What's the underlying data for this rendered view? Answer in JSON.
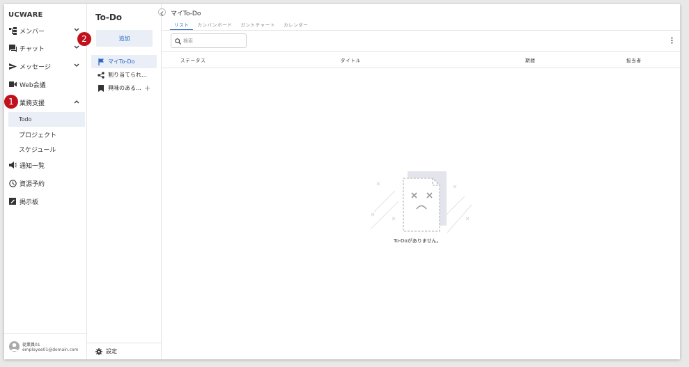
{
  "app": {
    "brand": "UCWARE"
  },
  "sidebar": {
    "items": [
      {
        "label": "メンバー",
        "icon": "org-chart-icon",
        "chevron": "chevron-down-icon"
      },
      {
        "label": "チャット",
        "icon": "chat-icon",
        "chevron": "chevron-down-icon"
      },
      {
        "label": "メッセージ",
        "icon": "send-icon",
        "chevron": "chevron-down-icon"
      },
      {
        "label": "Web会議",
        "icon": "video-icon"
      },
      {
        "label": "業務支援",
        "icon": "briefcase-icon",
        "chevron": "chevron-up-icon"
      },
      {
        "label": "通知一覧",
        "icon": "megaphone-icon"
      },
      {
        "label": "資源予約",
        "icon": "clock-icon"
      },
      {
        "label": "掲示板",
        "icon": "board-icon"
      }
    ],
    "subitems": [
      {
        "label": "Todo",
        "active": true
      },
      {
        "label": "プロジェクト"
      },
      {
        "label": "スケジュール"
      }
    ],
    "user": {
      "name": "従業員01",
      "email": "employee01@domain.com"
    }
  },
  "todo_panel": {
    "title": "To-Do",
    "add_label": "追加",
    "lists": [
      {
        "label": "マイTo-Do",
        "icon": "flag-icon",
        "active": true
      },
      {
        "label": "割り当てられ…",
        "icon": "share-icon"
      },
      {
        "label": "興味のある…",
        "icon": "bookmark-icon",
        "plus": "+"
      }
    ],
    "settings_label": "設定"
  },
  "main": {
    "title": "マイTo-Do",
    "tabs": [
      {
        "label": "リスト",
        "active": true
      },
      {
        "label": "カンバンボード"
      },
      {
        "label": "ガントチャート"
      },
      {
        "label": "カレンダー"
      }
    ],
    "search_placeholder": "検索",
    "columns": [
      "ステータス",
      "タイトル",
      "期間",
      "担当者"
    ],
    "empty_message": "To-Doがありません。"
  },
  "annotations": [
    "1",
    "2"
  ],
  "colors": {
    "accent": "#2d66c4",
    "active_bg": "#e9eef7",
    "badge": "#c0121c"
  }
}
